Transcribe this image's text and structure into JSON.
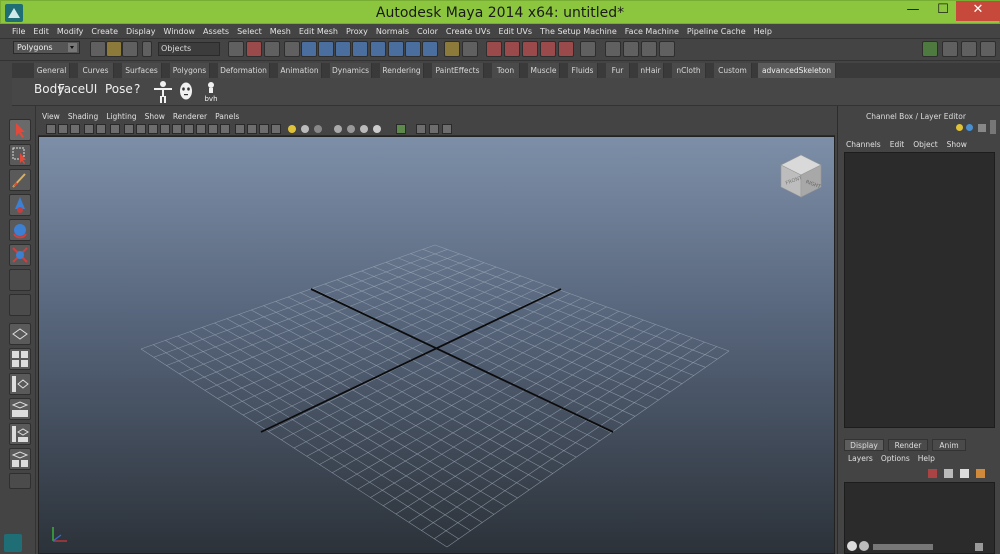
{
  "window": {
    "title": "Autodesk Maya 2014 x64: untitled*",
    "minimize_glyph": "—",
    "maximize_glyph": "☐",
    "close_glyph": "✕"
  },
  "menubar": [
    "File",
    "Edit",
    "Modify",
    "Create",
    "Display",
    "Window",
    "Assets",
    "Select",
    "Mesh",
    "Edit Mesh",
    "Proxy",
    "Normals",
    "Color",
    "Create UVs",
    "Edit UVs",
    "The Setup Machine",
    "Face Machine",
    "Pipeline Cache",
    "Help"
  ],
  "status_line": {
    "mode_dropdown": "Polygons",
    "selection_field": "Objects"
  },
  "shelf_tabs": [
    "General",
    "Curves",
    "Surfaces",
    "Polygons",
    "Deformation",
    "Animation",
    "Dynamics",
    "Rendering",
    "PaintEffects",
    "Toon",
    "Muscle",
    "Fluids",
    "Fur",
    "nHair",
    "nCloth",
    "Custom",
    "advancedSkeleton"
  ],
  "shelf_active_tab": "advancedSkeleton",
  "shelf_buttons": {
    "body": "Body",
    "face": "Face",
    "ui": "UI",
    "pose": "Pose",
    "help": "?",
    "bvh": "bvh"
  },
  "viewport": {
    "menu": [
      "View",
      "Shading",
      "Lighting",
      "Show",
      "Renderer",
      "Panels"
    ],
    "viewcube": {
      "front": "FRONT",
      "right": "RIGHT"
    }
  },
  "channel_box": {
    "title": "Channel Box / Layer Editor",
    "menu": [
      "Channels",
      "Edit",
      "Object",
      "Show"
    ]
  },
  "layer_editor": {
    "tabs": [
      "Display",
      "Render",
      "Anim"
    ],
    "active_tab": "Display",
    "menu": [
      "Layers",
      "Options",
      "Help"
    ]
  },
  "colors": {
    "title_bar": "#8cc63f",
    "close_button": "#c7493c",
    "ui_background": "#444444",
    "viewport_top": "#7d8fa8",
    "viewport_bottom": "#2c3239"
  }
}
